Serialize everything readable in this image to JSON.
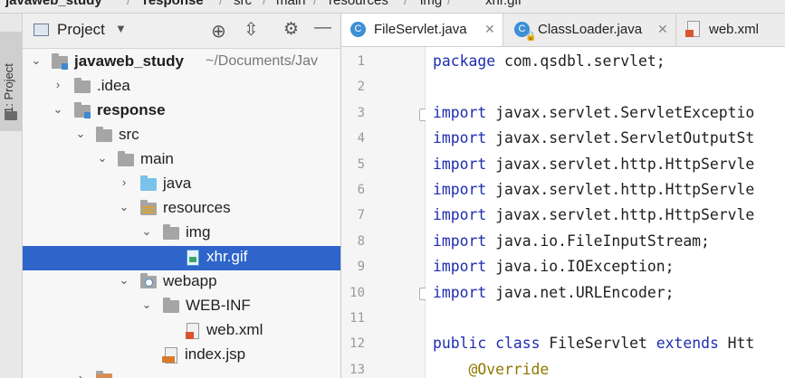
{
  "breadcrumb": {
    "items": [
      "javaweb_study",
      "response",
      "src",
      "main",
      "resources",
      "img",
      "xhr.gif"
    ]
  },
  "tool_window_strip": {
    "project_label": "1: Project"
  },
  "project_panel": {
    "title": "Project",
    "tree": [
      {
        "label": "javaweb_study",
        "hint": "~/Documents/Jav",
        "bold": true,
        "arrow": "down"
      },
      {
        "label": ".idea",
        "arrow": "right"
      },
      {
        "label": "response",
        "bold": true,
        "arrow": "down"
      },
      {
        "label": "src",
        "arrow": "down"
      },
      {
        "label": "main",
        "arrow": "down"
      },
      {
        "label": "java",
        "arrow": "right"
      },
      {
        "label": "resources",
        "arrow": "down"
      },
      {
        "label": "img",
        "arrow": "down"
      },
      {
        "label": "xhr.gif",
        "selected": true
      },
      {
        "label": "webapp",
        "arrow": "down"
      },
      {
        "label": "WEB-INF",
        "arrow": "down"
      },
      {
        "label": "web.xml"
      },
      {
        "label": "index.jsp"
      }
    ]
  },
  "editor": {
    "tabs": [
      {
        "label": "FileServlet.java",
        "active": true
      },
      {
        "label": "ClassLoader.java",
        "active": false
      },
      {
        "label": "web.xml",
        "active": false
      }
    ],
    "lines": [
      {
        "n": "1",
        "parts": [
          [
            "kw",
            "package"
          ],
          [
            "t",
            " com.qsdbl.servlet;"
          ]
        ]
      },
      {
        "n": "2",
        "parts": []
      },
      {
        "n": "3",
        "parts": [
          [
            "kw",
            "import"
          ],
          [
            "t",
            " javax.servlet.ServletExceptio"
          ]
        ]
      },
      {
        "n": "4",
        "parts": [
          [
            "kw",
            "import"
          ],
          [
            "t",
            " javax.servlet.ServletOutputSt"
          ]
        ]
      },
      {
        "n": "5",
        "parts": [
          [
            "kw",
            "import"
          ],
          [
            "t",
            " javax.servlet.http.HttpServle"
          ]
        ]
      },
      {
        "n": "6",
        "parts": [
          [
            "kw",
            "import"
          ],
          [
            "t",
            " javax.servlet.http.HttpServle"
          ]
        ]
      },
      {
        "n": "7",
        "parts": [
          [
            "kw",
            "import"
          ],
          [
            "t",
            " javax.servlet.http.HttpServle"
          ]
        ]
      },
      {
        "n": "8",
        "parts": [
          [
            "kw",
            "import"
          ],
          [
            "t",
            " java.io.FileInputStream;"
          ]
        ]
      },
      {
        "n": "9",
        "parts": [
          [
            "kw",
            "import"
          ],
          [
            "t",
            " java.io.IOException;"
          ]
        ]
      },
      {
        "n": "10",
        "parts": [
          [
            "kw",
            "import"
          ],
          [
            "t",
            " java.net.URLEncoder;"
          ]
        ]
      },
      {
        "n": "11",
        "parts": []
      },
      {
        "n": "12",
        "parts": [
          [
            "kw",
            "public"
          ],
          [
            "t",
            " "
          ],
          [
            "kw",
            "class"
          ],
          [
            "t",
            " FileServlet "
          ],
          [
            "kw",
            "extends"
          ],
          [
            "t",
            " Htt"
          ]
        ]
      },
      {
        "n": "13",
        "parts": [
          [
            "t",
            "    "
          ],
          [
            "ann",
            "@Override"
          ]
        ]
      }
    ]
  },
  "colors": {
    "selection": "#2f65ca",
    "keyword": "#1f2db0",
    "annotation": "#8c7a00",
    "folder_blue": "#79c3ea",
    "folder_gray": "#a5a5a5"
  }
}
